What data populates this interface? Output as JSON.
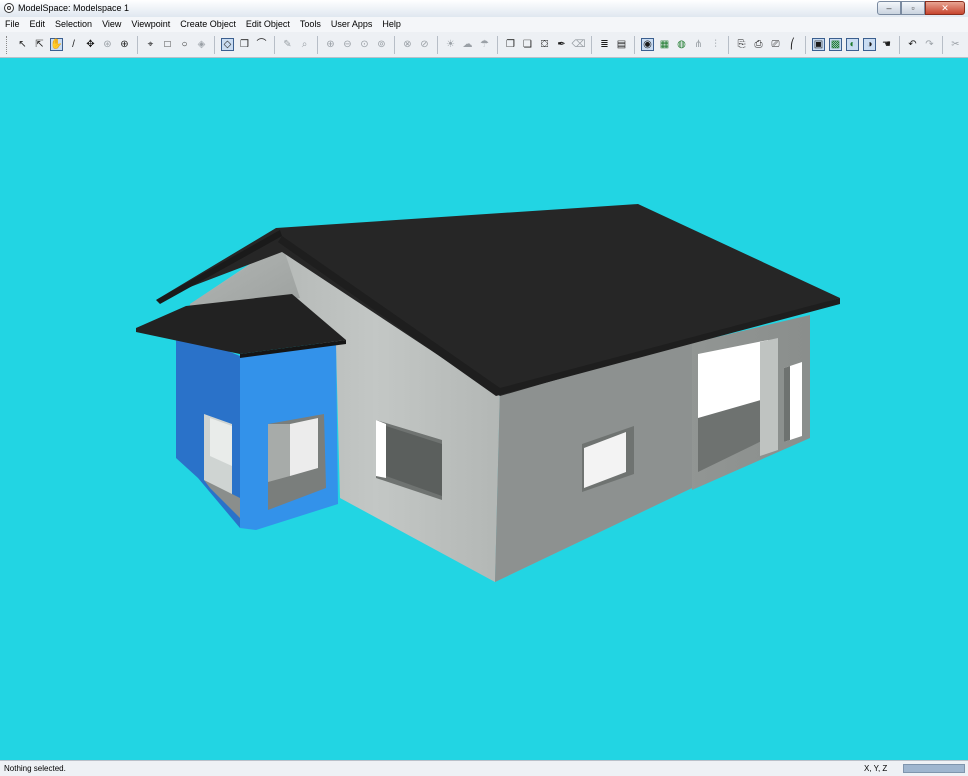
{
  "window": {
    "title": "ModelSpace: Modelspace 1"
  },
  "window_controls": {
    "minimize": "–",
    "restore": "▫",
    "close": "✕"
  },
  "menu": [
    "File",
    "Edit",
    "Selection",
    "View",
    "Viewpoint",
    "Create Object",
    "Edit Object",
    "Tools",
    "User Apps",
    "Help"
  ],
  "toolbar": {
    "groups": [
      [
        {
          "name": "select-arrow-icon",
          "glyph": "↖"
        },
        {
          "name": "select-plus-icon",
          "glyph": "⇱"
        },
        {
          "name": "pan-hand-icon",
          "glyph": "✋",
          "active": true
        },
        {
          "name": "pencil-icon",
          "glyph": "/"
        },
        {
          "name": "move-arrows-icon",
          "glyph": "✥"
        },
        {
          "name": "rotate-icon",
          "glyph": "⊛",
          "dim": true
        },
        {
          "name": "orbit-icon",
          "glyph": "⊕"
        }
      ],
      [
        {
          "name": "lasso-icon",
          "glyph": "⌖"
        },
        {
          "name": "rectangle-select-icon",
          "glyph": "□"
        },
        {
          "name": "circle-select-icon",
          "glyph": "○"
        },
        {
          "name": "cube-select-icon",
          "glyph": "◈",
          "dim": true
        }
      ],
      [
        {
          "name": "draw-mode-icon",
          "glyph": "◇",
          "active": true
        },
        {
          "name": "box-mode-icon",
          "glyph": "❒"
        },
        {
          "name": "walk-mode-icon",
          "glyph": "⌒"
        }
      ],
      [
        {
          "name": "measure-icon",
          "glyph": "✎",
          "dim": true
        },
        {
          "name": "zoom-window-icon",
          "glyph": "⌕",
          "dim": true
        }
      ],
      [
        {
          "name": "zoom-in-icon",
          "glyph": "⊕",
          "dim": true
        },
        {
          "name": "zoom-out-icon",
          "glyph": "⊖",
          "dim": true
        },
        {
          "name": "zoom-extents-icon",
          "glyph": "⊙",
          "dim": true
        },
        {
          "name": "zoom-fit-icon",
          "glyph": "⊚",
          "dim": true
        }
      ],
      [
        {
          "name": "view-front-icon",
          "glyph": "⊗",
          "dim": true
        },
        {
          "name": "view-back-icon",
          "glyph": "⊘",
          "dim": true
        }
      ],
      [
        {
          "name": "light-icon",
          "glyph": "☀",
          "dim": true
        },
        {
          "name": "shade-icon",
          "glyph": "☁",
          "dim": true
        },
        {
          "name": "texture-icon",
          "glyph": "☂",
          "dim": true
        }
      ],
      [
        {
          "name": "copy-object-icon",
          "glyph": "❐"
        },
        {
          "name": "paste-object-icon",
          "glyph": "❏"
        },
        {
          "name": "paint-bucket-icon",
          "glyph": "⛋"
        },
        {
          "name": "eyedropper-icon",
          "glyph": "✒"
        },
        {
          "name": "eraser-icon",
          "glyph": "⌫",
          "dim": true
        }
      ],
      [
        {
          "name": "layers-icon",
          "glyph": "≣"
        },
        {
          "name": "object-properties-icon",
          "glyph": "▤"
        }
      ],
      [
        {
          "name": "render-icon",
          "glyph": "◉",
          "active": true
        },
        {
          "name": "grid-color-icon",
          "glyph": "▦",
          "color": true
        },
        {
          "name": "globe-icon",
          "glyph": "◍",
          "color": true
        },
        {
          "name": "snap-icon",
          "glyph": "⋔",
          "dim": true
        },
        {
          "name": "align-icon",
          "glyph": "⫶",
          "dim": true
        }
      ],
      [
        {
          "name": "camera-1-icon",
          "glyph": "⎘"
        },
        {
          "name": "camera-2-icon",
          "glyph": "⎙"
        },
        {
          "name": "camera-3-icon",
          "glyph": "⎚"
        },
        {
          "name": "camera-4-icon",
          "glyph": "⎛"
        }
      ],
      [
        {
          "name": "view-toggle-1-icon",
          "glyph": "▣",
          "active": true
        },
        {
          "name": "view-toggle-2-icon",
          "glyph": "▩",
          "active": true,
          "color": true
        },
        {
          "name": "view-toggle-3-icon",
          "glyph": "◐",
          "active": true,
          "color": true
        },
        {
          "name": "view-toggle-4-icon",
          "glyph": "◑",
          "active": true
        },
        {
          "name": "grab-hand-icon",
          "glyph": "☚"
        }
      ],
      [
        {
          "name": "undo-icon",
          "glyph": "↶"
        },
        {
          "name": "redo-icon",
          "glyph": "↷",
          "dim": true
        }
      ],
      [
        {
          "name": "cut-icon",
          "glyph": "✂",
          "dim": true
        }
      ]
    ]
  },
  "viewport": {
    "background": "#22d5e3",
    "object": "house-model"
  },
  "colors": {
    "roof": "#2a2a2a",
    "wall_light": "#b6bab8",
    "wall_dark": "#8f9391",
    "porch_blue": "#2f86dd",
    "porch_blue_dark": "#1f5fb0"
  },
  "status": {
    "message": "Nothing selected.",
    "coords": "X, Y, Z"
  }
}
